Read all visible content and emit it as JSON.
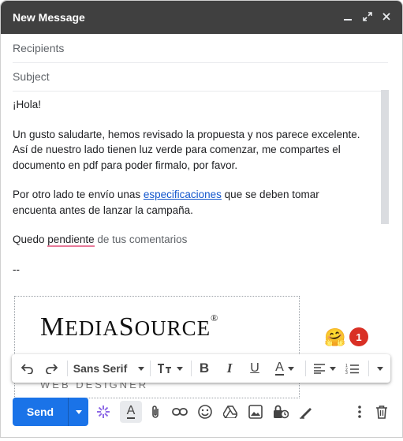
{
  "compose": {
    "title": "New Message",
    "recipients_placeholder": "Recipients",
    "subject_placeholder": "Subject"
  },
  "body": {
    "greeting": "¡Hola!",
    "para1_line1": "Un gusto saludarte, hemos revisado la propuesta y nos parece excelente.",
    "para1_line2": "Así de nuestro lado tienen luz verde para comenzar, me compartes el",
    "para1_line3": "documento en pdf para poder firmalo, por favor.",
    "para2_before_link": "Por otro lado te envío unas ",
    "para2_link": "especificaciones",
    "para2_after_link": " que se deben tomar",
    "para2_line2": "encuenta antes de lanzar la campaña.",
    "closing_before": "Quedo ",
    "closing_misspelled": "pendiente",
    "closing_after": " de tus comentarios",
    "sig_separator": "--"
  },
  "signature": {
    "logo_M": "M",
    "logo_edia": "EDIA",
    "logo_S": "S",
    "logo_ource": "OURCE",
    "logo_reg": "®",
    "subtitle": "WEB DESIGNER"
  },
  "notification": {
    "count": "1"
  },
  "format_toolbar": {
    "font_family": "Sans Serif"
  },
  "toolbar": {
    "send_label": "Send"
  },
  "colors": {
    "titlebar": "#404040",
    "send": "#1a73e8",
    "link": "#1155cc",
    "badge": "#d93025"
  }
}
